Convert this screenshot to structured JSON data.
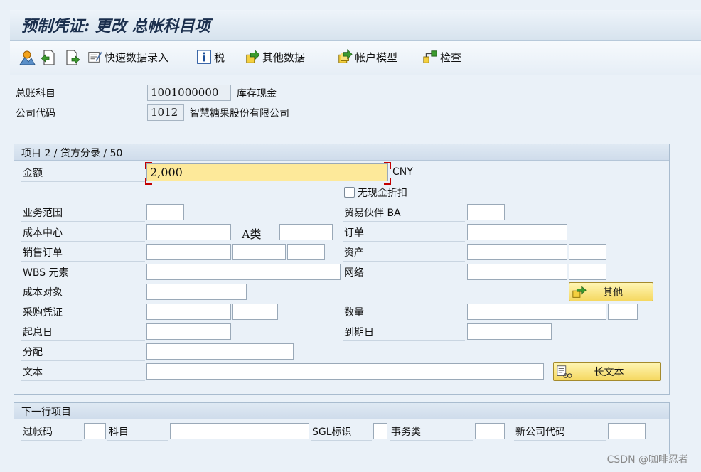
{
  "window": {
    "title": "预制凭证: 更改 总帐科目项"
  },
  "toolbar": {
    "fast_entry": "快速数据录入",
    "tax": "税",
    "other_data": "其他数据",
    "account_model": "帐户模型",
    "check": "检查"
  },
  "header": {
    "gl_account_label": "总账科目",
    "gl_account_value": "1001000000",
    "gl_account_text": "库存现金",
    "company_code_label": "公司代码",
    "company_code_value": "1012",
    "company_code_text": "智慧糖果股份有限公司"
  },
  "item": {
    "group_title": "项目 2 / 贷方分录 / 50",
    "amount_label": "金额",
    "amount_value": "2,000",
    "currency": "CNY",
    "no_cash_discount": "无现金折扣",
    "business_area": "业务范围",
    "trading_partner_ba": "贸易伙伴 BA",
    "cost_center": "成本中心",
    "a_class": "A类",
    "order": "订单",
    "sales_order": "销售订单",
    "asset": "资产",
    "wbs_element": "WBS 元素",
    "network": "网络",
    "cost_object": "成本对象",
    "more_button": "其他",
    "purchasing_doc": "采购凭证",
    "quantity": "数量",
    "value_date": "起息日",
    "due_date": "到期日",
    "assignment": "分配",
    "text": "文本",
    "long_text_button": "长文本"
  },
  "next_item": {
    "group_title": "下一行项目",
    "posting_key": "过帐码",
    "account": "科目",
    "sgl_indicator": "SGL标识",
    "transaction_type": "事务类",
    "new_company_code": "新公司代码"
  },
  "watermark": "CSDN @咖啡忍者"
}
